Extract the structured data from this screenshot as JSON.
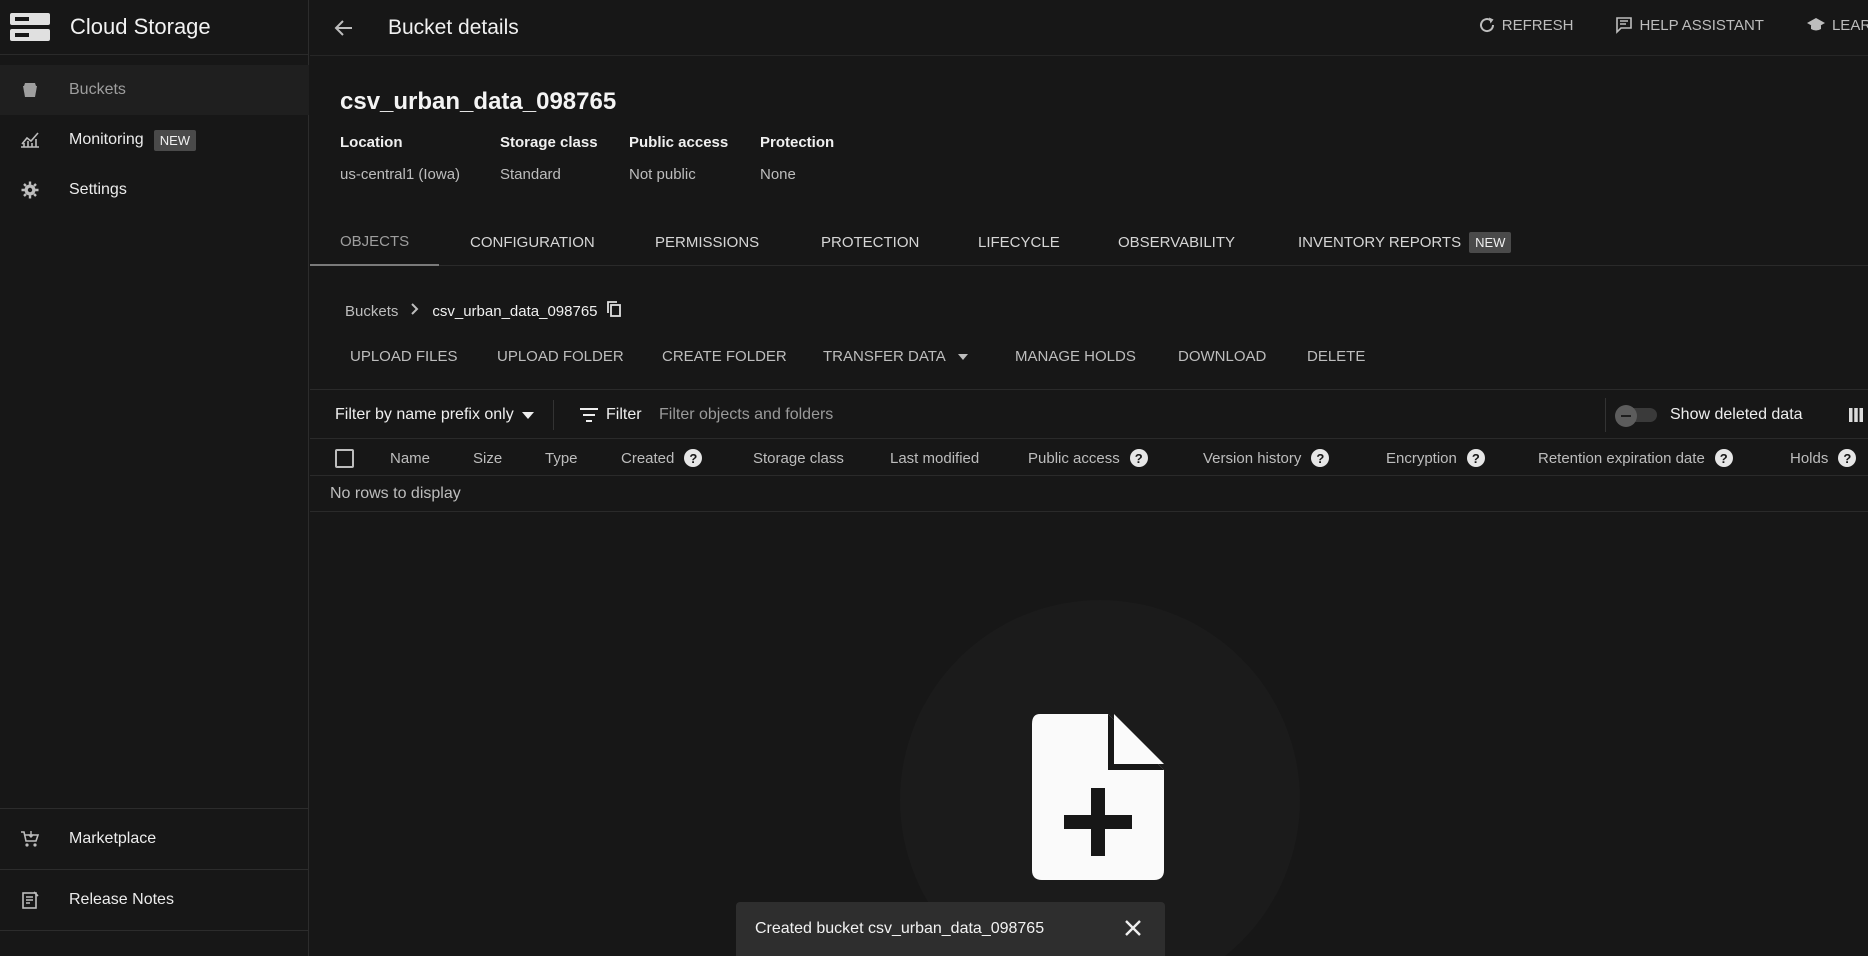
{
  "sidebar": {
    "title": "Cloud Storage",
    "items": [
      {
        "label": "Buckets",
        "icon": "bucket-icon"
      },
      {
        "label": "Monitoring",
        "icon": "chart-icon",
        "badge": "NEW"
      },
      {
        "label": "Settings",
        "icon": "gear-icon"
      }
    ],
    "footer": [
      {
        "label": "Marketplace",
        "icon": "cart-icon"
      },
      {
        "label": "Release Notes",
        "icon": "notes-icon"
      }
    ]
  },
  "topbar": {
    "title": "Bucket details",
    "refresh": "REFRESH",
    "help": "HELP ASSISTANT",
    "learn": "LEARN"
  },
  "bucket": {
    "name": "csv_urban_data_098765",
    "meta": [
      {
        "key": "Location",
        "value": "us-central1 (Iowa)"
      },
      {
        "key": "Storage class",
        "value": "Standard"
      },
      {
        "key": "Public access",
        "value": "Not public"
      },
      {
        "key": "Protection",
        "value": "None"
      }
    ]
  },
  "tabs": [
    "OBJECTS",
    "CONFIGURATION",
    "PERMISSIONS",
    "PROTECTION",
    "LIFECYCLE",
    "OBSERVABILITY",
    "INVENTORY REPORTS"
  ],
  "tab_badge": "NEW",
  "breadcrumb": {
    "root": "Buckets",
    "current": "csv_urban_data_098765"
  },
  "actions": [
    "UPLOAD FILES",
    "UPLOAD FOLDER",
    "CREATE FOLDER",
    "TRANSFER DATA",
    "MANAGE HOLDS",
    "DOWNLOAD",
    "DELETE"
  ],
  "filter": {
    "prefix": "Filter by name prefix only",
    "label": "Filter",
    "placeholder": "Filter objects and folders",
    "show_deleted": "Show deleted data",
    "show_deleted_on": false
  },
  "columns": [
    "Name",
    "Size",
    "Type",
    "Created",
    "Storage class",
    "Last modified",
    "Public access",
    "Version history",
    "Encryption",
    "Retention expiration date",
    "Holds"
  ],
  "empty_text": "No rows to display",
  "snackbar": {
    "message": "Created bucket csv_urban_data_098765"
  }
}
